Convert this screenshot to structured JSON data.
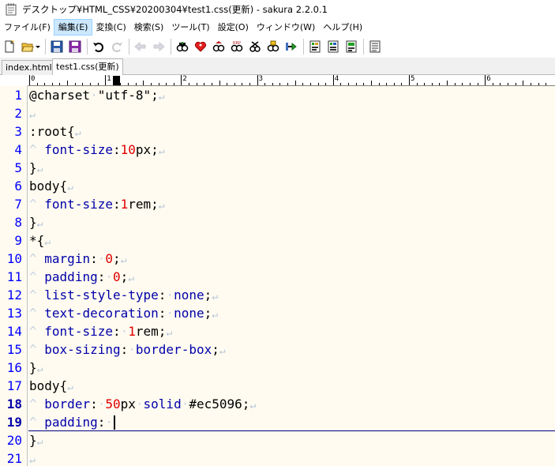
{
  "window": {
    "title": "デスクトップ¥HTML_CSS¥20200304¥test1.css(更新) - sakura 2.2.0.1"
  },
  "menu": [
    {
      "label": "ファイル(F)"
    },
    {
      "label": "編集(E)",
      "active": true
    },
    {
      "label": "変換(C)"
    },
    {
      "label": "検索(S)"
    },
    {
      "label": "ツール(T)"
    },
    {
      "label": "設定(O)"
    },
    {
      "label": "ウィンドウ(W)"
    },
    {
      "label": "ヘルプ(H)"
    }
  ],
  "toolbar": {
    "icons": [
      "new-file-icon",
      "open-file-icon",
      "save-icon",
      "save-all-icon",
      "undo-icon",
      "redo-icon",
      "jump-back-icon",
      "jump-forward-icon",
      "search-icon",
      "search-heart-icon",
      "search-prev-icon",
      "search-next-icon",
      "replace-icon",
      "bookmark-search-icon",
      "grep-icon",
      "outline-icon",
      "compare-icon",
      "tag-jump-icon",
      "settings-icon"
    ]
  },
  "tabs": [
    {
      "label": "index.html",
      "active": false
    },
    {
      "label": "test1.css(更新)",
      "active": true
    }
  ],
  "ruler": {
    "labels": [
      "0",
      "1",
      "2",
      "3",
      "4",
      "5",
      "6"
    ]
  },
  "editor": {
    "current_line": 19,
    "lines": [
      {
        "n": "1",
        "parts": [
          [
            "t",
            "@charset"
          ],
          [
            "ws",
            "·"
          ],
          [
            "t",
            "\"utf-8\";"
          ],
          [
            "crlf",
            "↵"
          ]
        ]
      },
      {
        "n": "2",
        "parts": [
          [
            "crlf",
            "↵"
          ]
        ]
      },
      {
        "n": "3",
        "parts": [
          [
            "t",
            ":root{"
          ],
          [
            "crlf",
            "↵"
          ]
        ]
      },
      {
        "n": "4",
        "parts": [
          [
            "ws",
            "^"
          ],
          [
            "t",
            " "
          ],
          [
            "kw",
            "font-size"
          ],
          [
            "t",
            ":"
          ],
          [
            "num",
            "10"
          ],
          [
            "t",
            "px;"
          ],
          [
            "crlf",
            "↵"
          ]
        ]
      },
      {
        "n": "5",
        "parts": [
          [
            "t",
            "}"
          ],
          [
            "crlf",
            "↵"
          ]
        ]
      },
      {
        "n": "6",
        "parts": [
          [
            "t",
            "body{"
          ],
          [
            "crlf",
            "↵"
          ]
        ]
      },
      {
        "n": "7",
        "parts": [
          [
            "ws",
            "^"
          ],
          [
            "t",
            " "
          ],
          [
            "kw",
            "font-size"
          ],
          [
            "t",
            ":"
          ],
          [
            "num",
            "1"
          ],
          [
            "t",
            "rem;"
          ],
          [
            "crlf",
            "↵"
          ]
        ]
      },
      {
        "n": "8",
        "parts": [
          [
            "t",
            "}"
          ],
          [
            "crlf",
            "↵"
          ]
        ]
      },
      {
        "n": "9",
        "parts": [
          [
            "t",
            "*{"
          ],
          [
            "crlf",
            "↵"
          ]
        ]
      },
      {
        "n": "10",
        "parts": [
          [
            "ws",
            "^"
          ],
          [
            "t",
            " "
          ],
          [
            "kw",
            "margin"
          ],
          [
            "t",
            ":"
          ],
          [
            "ws",
            "·"
          ],
          [
            "num",
            "0"
          ],
          [
            "t",
            ";"
          ],
          [
            "crlf",
            "↵"
          ]
        ]
      },
      {
        "n": "11",
        "parts": [
          [
            "ws",
            "^"
          ],
          [
            "t",
            " "
          ],
          [
            "kw",
            "padding"
          ],
          [
            "t",
            ":"
          ],
          [
            "ws",
            "·"
          ],
          [
            "num",
            "0"
          ],
          [
            "t",
            ";"
          ],
          [
            "crlf",
            "↵"
          ]
        ]
      },
      {
        "n": "12",
        "parts": [
          [
            "ws",
            "^"
          ],
          [
            "t",
            " "
          ],
          [
            "kw",
            "list-style-type"
          ],
          [
            "t",
            ":"
          ],
          [
            "ws",
            "·"
          ],
          [
            "kw",
            "none"
          ],
          [
            "t",
            ";"
          ],
          [
            "crlf",
            "↵"
          ]
        ]
      },
      {
        "n": "13",
        "parts": [
          [
            "ws",
            "^"
          ],
          [
            "t",
            " "
          ],
          [
            "kw",
            "text-decoration"
          ],
          [
            "t",
            ":"
          ],
          [
            "ws",
            "·"
          ],
          [
            "kw",
            "none"
          ],
          [
            "t",
            ";"
          ],
          [
            "crlf",
            "↵"
          ]
        ]
      },
      {
        "n": "14",
        "parts": [
          [
            "ws",
            "^"
          ],
          [
            "t",
            " "
          ],
          [
            "kw",
            "font-size"
          ],
          [
            "t",
            ":"
          ],
          [
            "ws",
            "·"
          ],
          [
            "num",
            "1"
          ],
          [
            "t",
            "rem;"
          ],
          [
            "crlf",
            "↵"
          ]
        ]
      },
      {
        "n": "15",
        "parts": [
          [
            "ws",
            "^"
          ],
          [
            "t",
            " "
          ],
          [
            "kw",
            "box-sizing"
          ],
          [
            "t",
            ":"
          ],
          [
            "ws",
            "·"
          ],
          [
            "kw",
            "border-box"
          ],
          [
            "t",
            ";"
          ],
          [
            "crlf",
            "↵"
          ]
        ]
      },
      {
        "n": "16",
        "parts": [
          [
            "t",
            "}"
          ],
          [
            "crlf",
            "↵"
          ]
        ]
      },
      {
        "n": "17",
        "parts": [
          [
            "t",
            "body{"
          ],
          [
            "crlf",
            "↵"
          ]
        ]
      },
      {
        "n": "18",
        "parts": [
          [
            "ws",
            "^"
          ],
          [
            "t",
            " "
          ],
          [
            "kw",
            "border"
          ],
          [
            "t",
            ":"
          ],
          [
            "ws",
            "·"
          ],
          [
            "num",
            "50"
          ],
          [
            "t",
            "px"
          ],
          [
            "ws",
            "·"
          ],
          [
            "kw",
            "solid"
          ],
          [
            "ws",
            "·"
          ],
          [
            "t",
            "#ec5096;"
          ],
          [
            "crlf",
            "↵"
          ]
        ]
      },
      {
        "n": "19",
        "parts": [
          [
            "ws",
            "^"
          ],
          [
            "t",
            " "
          ],
          [
            "kw",
            "padding"
          ],
          [
            "t",
            ":"
          ],
          [
            "ws",
            "·"
          ]
        ]
      },
      {
        "n": "20",
        "parts": [
          [
            "t",
            "}"
          ],
          [
            "crlf",
            "↵"
          ]
        ]
      },
      {
        "n": "21",
        "parts": [
          [
            "crlf",
            "↵"
          ]
        ]
      }
    ]
  }
}
